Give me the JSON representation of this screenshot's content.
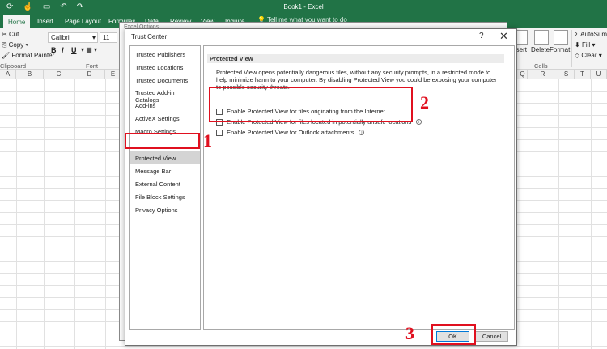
{
  "app": {
    "title": "Book1 - Excel"
  },
  "ribbon_tabs": [
    "Home",
    "Insert",
    "Page Layout",
    "Formulas",
    "Data",
    "Review",
    "View",
    "Inquire"
  ],
  "tell_me": "Tell me what you want to do",
  "clipboard": {
    "cut": "Cut",
    "copy": "Copy",
    "format_painter": "Format Painter",
    "group": "Clipboard"
  },
  "font": {
    "name": "Calibri",
    "size": "11",
    "group": "Font",
    "bold": "B",
    "italic": "I",
    "underline": "U"
  },
  "cells_group": {
    "insert": "Insert",
    "delete": "Delete",
    "format": "Format",
    "group": "Cells"
  },
  "editing": {
    "autosum": "AutoSum",
    "fill": "Fill",
    "clear": "Clear"
  },
  "columns_left": [
    "A",
    "B",
    "C",
    "D",
    "E"
  ],
  "columns_right": [
    "Q",
    "R",
    "S",
    "T",
    "U"
  ],
  "excel_options": {
    "title": "Excel Options"
  },
  "trust_center": {
    "title": "Trust Center",
    "help": "?",
    "close": "✕",
    "nav": [
      "Trusted Publishers",
      "Trusted Locations",
      "Trusted Documents",
      "Trusted Add-in Catalogs",
      "Add-ins",
      "ActiveX Settings",
      "Macro Settings",
      "Protected View",
      "Message Bar",
      "External Content",
      "File Block Settings",
      "Privacy Options"
    ],
    "section_title": "Protected View",
    "description": "Protected View opens potentially dangerous files, without any security prompts, in a restricted mode to help minimize harm to your computer. By disabling Protected View you could be exposing your computer to possible security threats.",
    "options": [
      "Enable Protected View for files originating from the Internet",
      "Enable Protected View for files located in potentially unsafe locations",
      "Enable Protected View for Outlook attachments"
    ],
    "ok": "OK",
    "cancel": "Cancel"
  },
  "annotations": [
    "1",
    "2",
    "3"
  ],
  "colors": {
    "excel_green": "#217346",
    "annotation_red": "#e0101f"
  }
}
